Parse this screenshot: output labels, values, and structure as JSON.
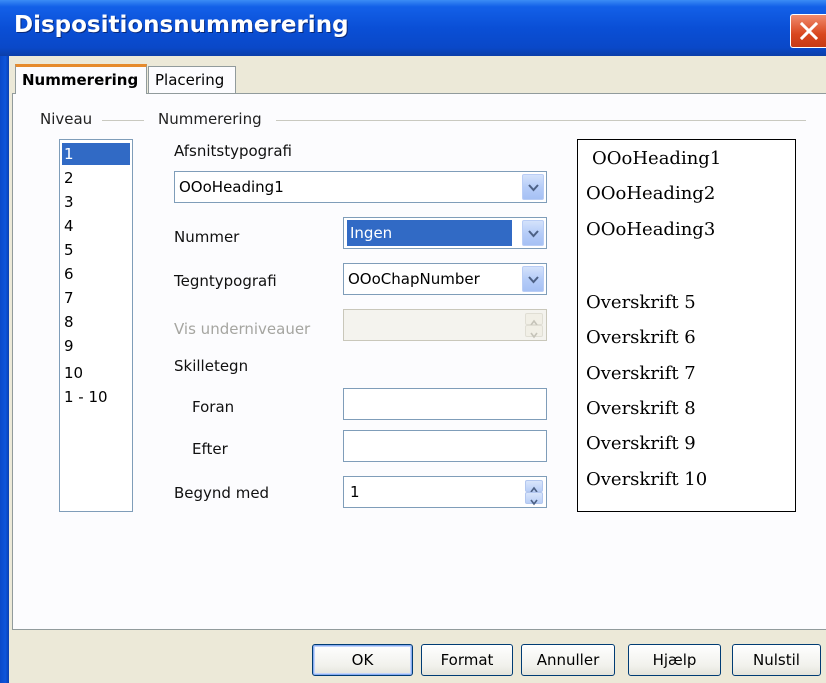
{
  "window": {
    "title": "Dispositionsnummerering"
  },
  "tabs": [
    {
      "label": "Nummerering",
      "active": true
    },
    {
      "label": "Placering",
      "active": false
    }
  ],
  "level_group": {
    "label": "Niveau",
    "items": [
      "1",
      "2",
      "3",
      "4",
      "5",
      "6",
      "7",
      "8",
      "9",
      "10",
      "1 - 10"
    ],
    "selected": "1"
  },
  "numbering_group": {
    "label": "Nummerering",
    "paragraph_style": {
      "label": "Afsnitstypografi",
      "value": "OOoHeading1"
    },
    "number": {
      "label": "Nummer",
      "value": "Ingen"
    },
    "char_style": {
      "label": "Tegntypografi",
      "value": "OOoChapNumber"
    },
    "show_sublevels": {
      "label": "Vis underniveauer",
      "value": "",
      "disabled": true
    },
    "separator": {
      "label": "Skilletegn"
    },
    "before": {
      "label": "Foran",
      "value": ""
    },
    "after": {
      "label": "Efter",
      "value": ""
    },
    "start_at": {
      "label": "Begynd med",
      "value": "1"
    }
  },
  "preview": {
    "items": [
      "OOoHeading1",
      "OOoHeading2",
      "OOoHeading3",
      "Overskrift 5",
      "Overskrift 6",
      "Overskrift 7",
      "Overskrift 8",
      "Overskrift 9",
      "Overskrift 10"
    ]
  },
  "buttons": {
    "ok": "OK",
    "format": "Format",
    "cancel": "Annuller",
    "help": "Hjælp",
    "reset": "Nulstil"
  },
  "colors": {
    "titlebar": "#0a4fd6",
    "selection": "#316ac5",
    "active_tab_accent": "#e68b2c",
    "close_button": "#d9471f"
  }
}
